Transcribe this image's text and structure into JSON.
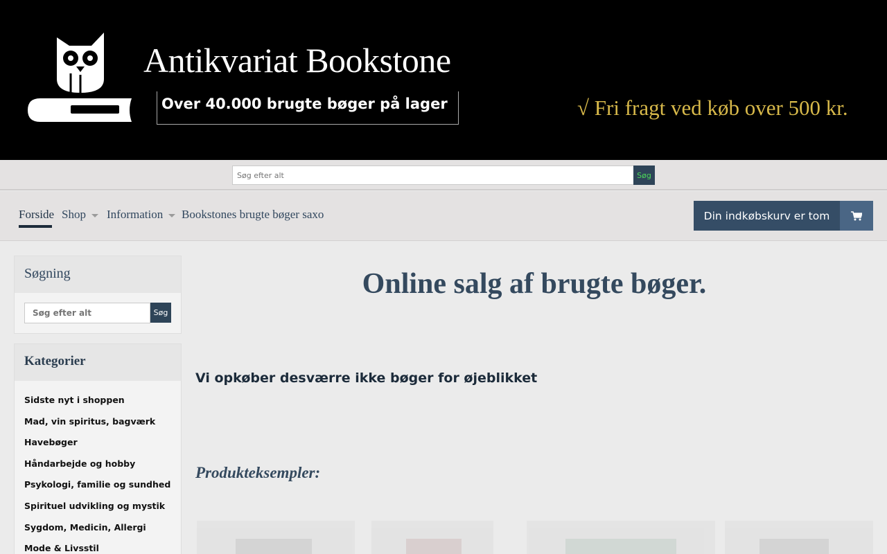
{
  "banner": {
    "title": "Antikvariat Bookstone",
    "subtitle": "Over 40.000 brugte bøger på lager",
    "shipping": "√ Fri fragt ved køb over 500 kr."
  },
  "top_search": {
    "placeholder": "Søg efter alt",
    "button_label": "Søg"
  },
  "nav": {
    "items": [
      {
        "label": "Forside",
        "active": true
      },
      {
        "label": "Shop",
        "has_dropdown": true
      },
      {
        "label": "Information",
        "has_dropdown": true
      },
      {
        "label": "Bookstones brugte bøger saxo"
      }
    ],
    "cart_label": "Din indkøbskurv er tom",
    "cart_icon": "shopping-cart-icon"
  },
  "sidebar": {
    "search_title": "Søgning",
    "search_placeholder": "Søg efter alt",
    "search_button": "Søg",
    "categories_title": "Kategorier",
    "categories": [
      "Sidste nyt i shoppen",
      "Mad, vin spiritus, bagværk",
      "Havebøger",
      "Håndarbejde og hobby",
      "Psykologi, familie og sundhed",
      "Spirituel udvikling og mystik",
      "Sygdom, Medicin, Allergi",
      "Mode & Livsstil"
    ]
  },
  "main": {
    "title": "Online salg af brugte bøger.",
    "notice": "Vi opkøber desværre ikke bøger for øjeblikket",
    "examples_heading": "Produkteksempler:"
  },
  "colors": {
    "banner_bg": "#000000",
    "shipping_gold": "#d8b94a",
    "accent_navy": "#2e4458",
    "cart_bg": "#354d66"
  }
}
